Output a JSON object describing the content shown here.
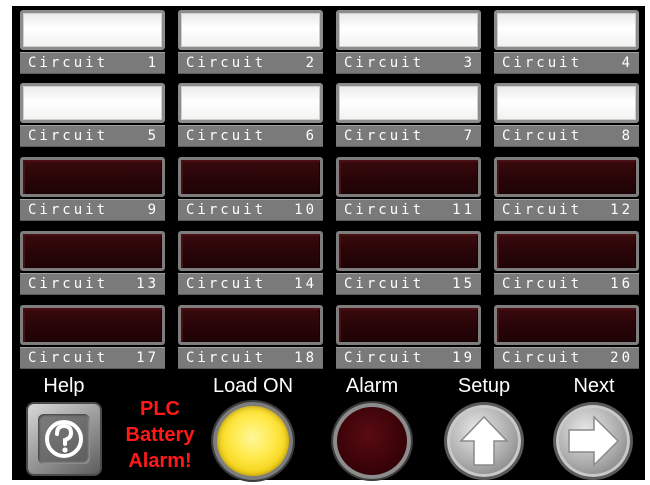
{
  "circuits": [
    {
      "label": "Circuit",
      "number": "1",
      "state": "on"
    },
    {
      "label": "Circuit",
      "number": "2",
      "state": "on"
    },
    {
      "label": "Circuit",
      "number": "3",
      "state": "on"
    },
    {
      "label": "Circuit",
      "number": "4",
      "state": "on"
    },
    {
      "label": "Circuit",
      "number": "5",
      "state": "on"
    },
    {
      "label": "Circuit",
      "number": "6",
      "state": "on"
    },
    {
      "label": "Circuit",
      "number": "7",
      "state": "on"
    },
    {
      "label": "Circuit",
      "number": "8",
      "state": "on"
    },
    {
      "label": "Circuit",
      "number": "9",
      "state": "off"
    },
    {
      "label": "Circuit",
      "number": "10",
      "state": "off"
    },
    {
      "label": "Circuit",
      "number": "11",
      "state": "off"
    },
    {
      "label": "Circuit",
      "number": "12",
      "state": "off"
    },
    {
      "label": "Circuit",
      "number": "13",
      "state": "off"
    },
    {
      "label": "Circuit",
      "number": "14",
      "state": "off"
    },
    {
      "label": "Circuit",
      "number": "15",
      "state": "off"
    },
    {
      "label": "Circuit",
      "number": "16",
      "state": "off"
    },
    {
      "label": "Circuit",
      "number": "17",
      "state": "off"
    },
    {
      "label": "Circuit",
      "number": "18",
      "state": "off"
    },
    {
      "label": "Circuit",
      "number": "19",
      "state": "off"
    },
    {
      "label": "Circuit",
      "number": "20",
      "state": "off"
    }
  ],
  "controls": {
    "help": {
      "label": "Help",
      "icon": "question-mark-icon"
    },
    "plc_alarm": {
      "line1": "PLC",
      "line2": "Battery",
      "line3": "Alarm!",
      "color": "#ff1a1a"
    },
    "load_on": {
      "label": "Load ON",
      "state": "on",
      "color": "#ffe94a"
    },
    "alarm": {
      "label": "Alarm",
      "state": "off",
      "color": "#3a0308"
    },
    "setup": {
      "label": "Setup",
      "icon": "arrow-up-icon"
    },
    "next": {
      "label": "Next",
      "icon": "arrow-right-icon"
    }
  },
  "colors": {
    "background": "#000000",
    "lamp_on": "#ffffff",
    "lamp_off": "#2a0508",
    "label_bar": "#7a7a7a"
  }
}
